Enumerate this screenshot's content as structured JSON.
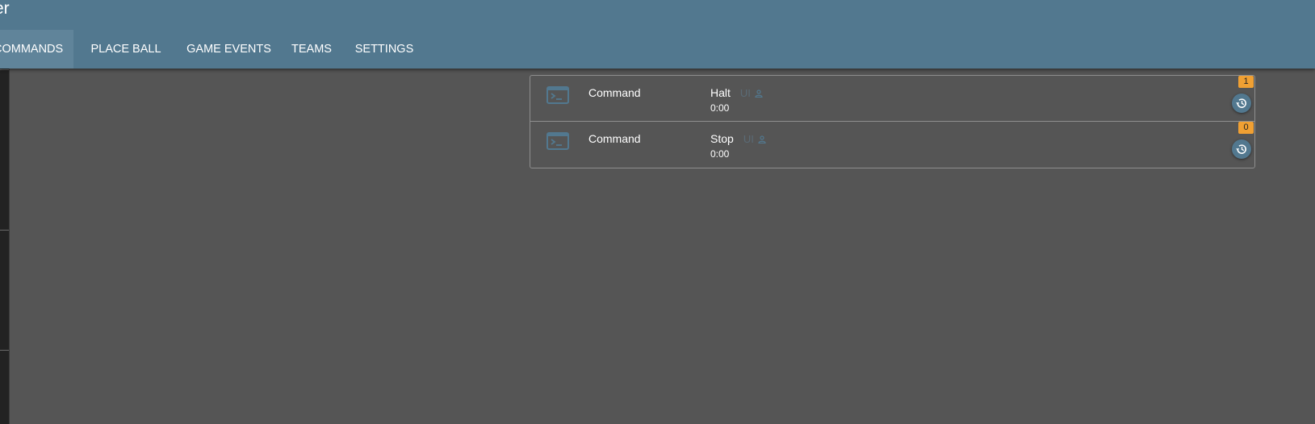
{
  "header": {
    "title": "er",
    "tabs": [
      {
        "label": "COMMANDS",
        "active": true
      },
      {
        "label": "PLACE BALL"
      },
      {
        "label": "GAME EVENTS"
      },
      {
        "label": "TEAMS"
      },
      {
        "label": "SETTINGS"
      }
    ]
  },
  "events": [
    {
      "icon": "terminal-icon",
      "type": "Command",
      "name": "Halt",
      "origin": "UI",
      "origin_icon": "person-icon",
      "time": "0:00",
      "badge": "1",
      "action_icon": "restore-icon"
    },
    {
      "icon": "terminal-icon",
      "type": "Command",
      "name": "Stop",
      "origin": "UI",
      "origin_icon": "person-icon",
      "time": "0:00",
      "badge": "0",
      "action_icon": "restore-icon"
    }
  ],
  "colors": {
    "header": "#52788f",
    "active_tab": "#60849a",
    "background": "#555555",
    "badge": "#f0a033",
    "drawer": "#222222"
  }
}
